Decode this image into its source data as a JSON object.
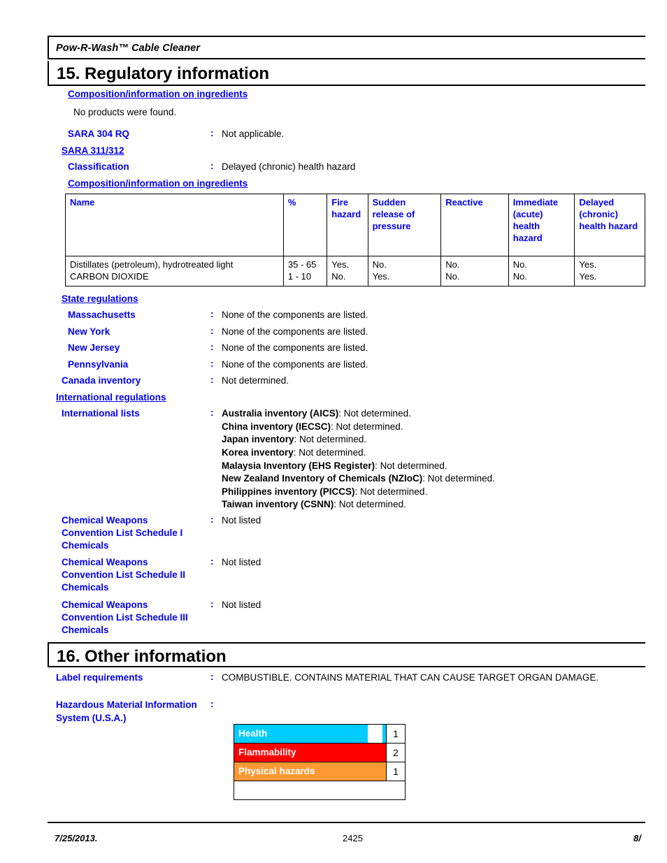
{
  "document": {
    "product_title": "Pow-R-Wash™ Cable Cleaner"
  },
  "section15": {
    "heading": "15. Regulatory information",
    "composition_heading": "Composition/information on ingredients",
    "no_products": "No products were found.",
    "sara_304_label": "SARA 304 RQ",
    "sara_304_value": "Not applicable.",
    "sara_311_312_heading": "SARA 311/312",
    "classification_label": "Classification",
    "classification_value": "Delayed (chronic) health hazard",
    "composition_heading2": "Composition/information on ingredients",
    "table": {
      "headers": [
        "Name",
        "%",
        "Fire hazard",
        "Sudden release of pressure",
        "Reactive",
        "Immediate (acute) health hazard",
        "Delayed (chronic) health hazard"
      ],
      "rows": [
        {
          "name": "Distillates (petroleum), hydrotreated light",
          "percent": "35 - 65",
          "fire": "Yes.",
          "sudden": "No.",
          "reactive": "No.",
          "immediate": "No.",
          "delayed": "Yes."
        },
        {
          "name": "CARBON DIOXIDE",
          "percent": "1 - 10",
          "fire": "No.",
          "sudden": "Yes.",
          "reactive": "No.",
          "immediate": "No.",
          "delayed": "Yes."
        }
      ]
    },
    "state_regulations_heading": "State regulations",
    "massachusetts_label": "Massachusetts",
    "massachusetts_value": "None of the components are listed.",
    "new_york_label": "New York",
    "new_york_value": "None of the components are listed.",
    "new_jersey_label": "New Jersey",
    "new_jersey_value": "None of the components are listed.",
    "pennsylvania_label": "Pennsylvania",
    "pennsylvania_value": "None of the components are listed.",
    "canada_inventory_label": "Canada inventory",
    "canada_inventory_value": "Not determined.",
    "international_regulations_heading": "International regulations",
    "international_lists_label": "International lists",
    "international_lists": [
      {
        "name": "Australia inventory (AICS)",
        "value": ": Not determined."
      },
      {
        "name": "China inventory (IECSC)",
        "value": ": Not determined."
      },
      {
        "name": "Japan inventory",
        "value": ": Not determined."
      },
      {
        "name": "Korea inventory",
        "value": ": Not determined."
      },
      {
        "name": "Malaysia Inventory (EHS Register)",
        "value": ": Not determined."
      },
      {
        "name": "New Zealand Inventory of Chemicals (NZIoC)",
        "value": ": Not determined."
      },
      {
        "name": "Philippines inventory (PICCS)",
        "value": ": Not determined."
      },
      {
        "name": "Taiwan inventory (CSNN)",
        "value": ": Not determined."
      }
    ],
    "cwc_schedule_1_label": "Chemical Weapons Convention List Schedule I Chemicals",
    "cwc_schedule_1_value": "Not listed",
    "cwc_schedule_2_label": "Chemical Weapons Convention List Schedule II Chemicals",
    "cwc_schedule_2_value": "Not listed",
    "cwc_schedule_3_label": "Chemical Weapons Convention List Schedule III Chemicals",
    "cwc_schedule_3_value": "Not listed"
  },
  "section16": {
    "heading": "16. Other information",
    "label_requirements_label": "Label requirements",
    "label_requirements_value": "COMBUSTIBLE.  CONTAINS MATERIAL THAT CAN CAUSE TARGET ORGAN DAMAGE.",
    "hmis_label": "Hazardous Material Information System (U.S.A.)",
    "hmis": {
      "rows": [
        {
          "name": "Health",
          "rating": "1",
          "color": "#00CCFF",
          "fill_percent": 88
        },
        {
          "name": "Flammability",
          "rating": "2",
          "color": "#FF0000",
          "fill_percent": 100
        },
        {
          "name": "Physical hazards",
          "rating": "1",
          "color": "#FF9933",
          "fill_percent": 100
        }
      ]
    }
  },
  "footer": {
    "date": "7/25/2013.",
    "center": "2425",
    "page": "8/"
  },
  "colons": {
    "mark": ":"
  }
}
